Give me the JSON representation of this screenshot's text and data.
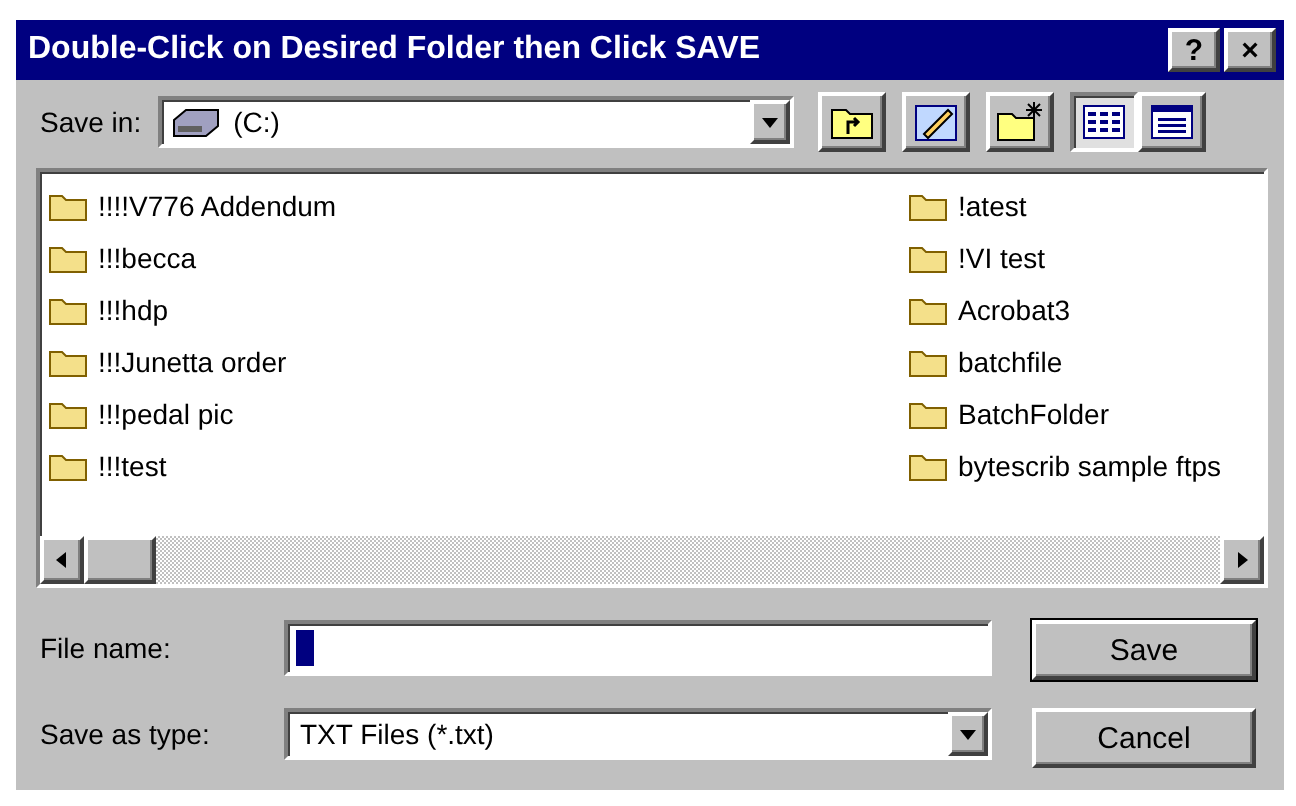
{
  "window": {
    "title": "Double-Click on Desired Folder then Click SAVE",
    "buttons": [
      "?",
      "×"
    ]
  },
  "save_in": {
    "label": "Save in:",
    "value": "(C:)"
  },
  "toolbar": [
    {
      "kind": "up",
      "selected": false
    },
    {
      "kind": "desktop",
      "selected": false
    },
    {
      "kind": "newfolder",
      "selected": false
    },
    {
      "kind": "list",
      "selected": true
    },
    {
      "kind": "details",
      "selected": false
    }
  ],
  "folders": [
    [
      "!!!!V776 Addendum",
      "!!!becca",
      "!!!hdp",
      "!!!Junetta order",
      "!!!pedal pic",
      "!!!test"
    ],
    [
      "!atest",
      "!VI test",
      "Acrobat3",
      "batchfile",
      "BatchFolder",
      "bytescrib sample ftps"
    ]
  ],
  "file_name": {
    "label": "File name:"
  },
  "save_as_type": {
    "label": "Save as type:",
    "value": "TXT Files (*.txt)"
  },
  "buttons": [
    {
      "label": "Save",
      "default": true
    },
    {
      "label": "Cancel",
      "default": false
    }
  ]
}
